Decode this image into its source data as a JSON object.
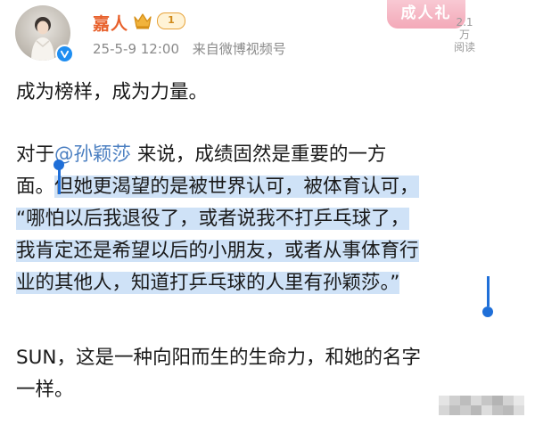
{
  "post": {
    "username": "嘉人",
    "level": "1",
    "date": "25-5-9 12:00",
    "source": "来自微博视频号"
  },
  "banner": {
    "text": "成人礼",
    "count": "2.1万",
    "count_label": "阅读"
  },
  "content": {
    "p1": "成为榜样，成为力量。",
    "p2_l1_pre": "对于",
    "mention": "@孙颖莎",
    "p2_l1_post": " 来说，成绩固然是重要的一方",
    "p2_l2_pre": "面。",
    "p2_l2_sel": "但她更渴望的是被世界认可，被体育认可，",
    "p2_l3": "“哪怕以后我退役了，或者说我不打乒乓球了，",
    "p2_l4": "我肯定还是希望以后的小朋友，或者从事体育行",
    "p2_l5": "业的其他人，知道打乒乓球的人里有孙颖莎。”",
    "p3_l1": "SUN，这是一种向阳而生的生命力，和她的名字",
    "p3_l2": "一样。"
  },
  "colors": {
    "username": "#e8612c",
    "mention": "#4b7fc1",
    "selection": "#cfe2f7",
    "handle": "#1f6fd8",
    "verified": "#1f8ef1"
  }
}
